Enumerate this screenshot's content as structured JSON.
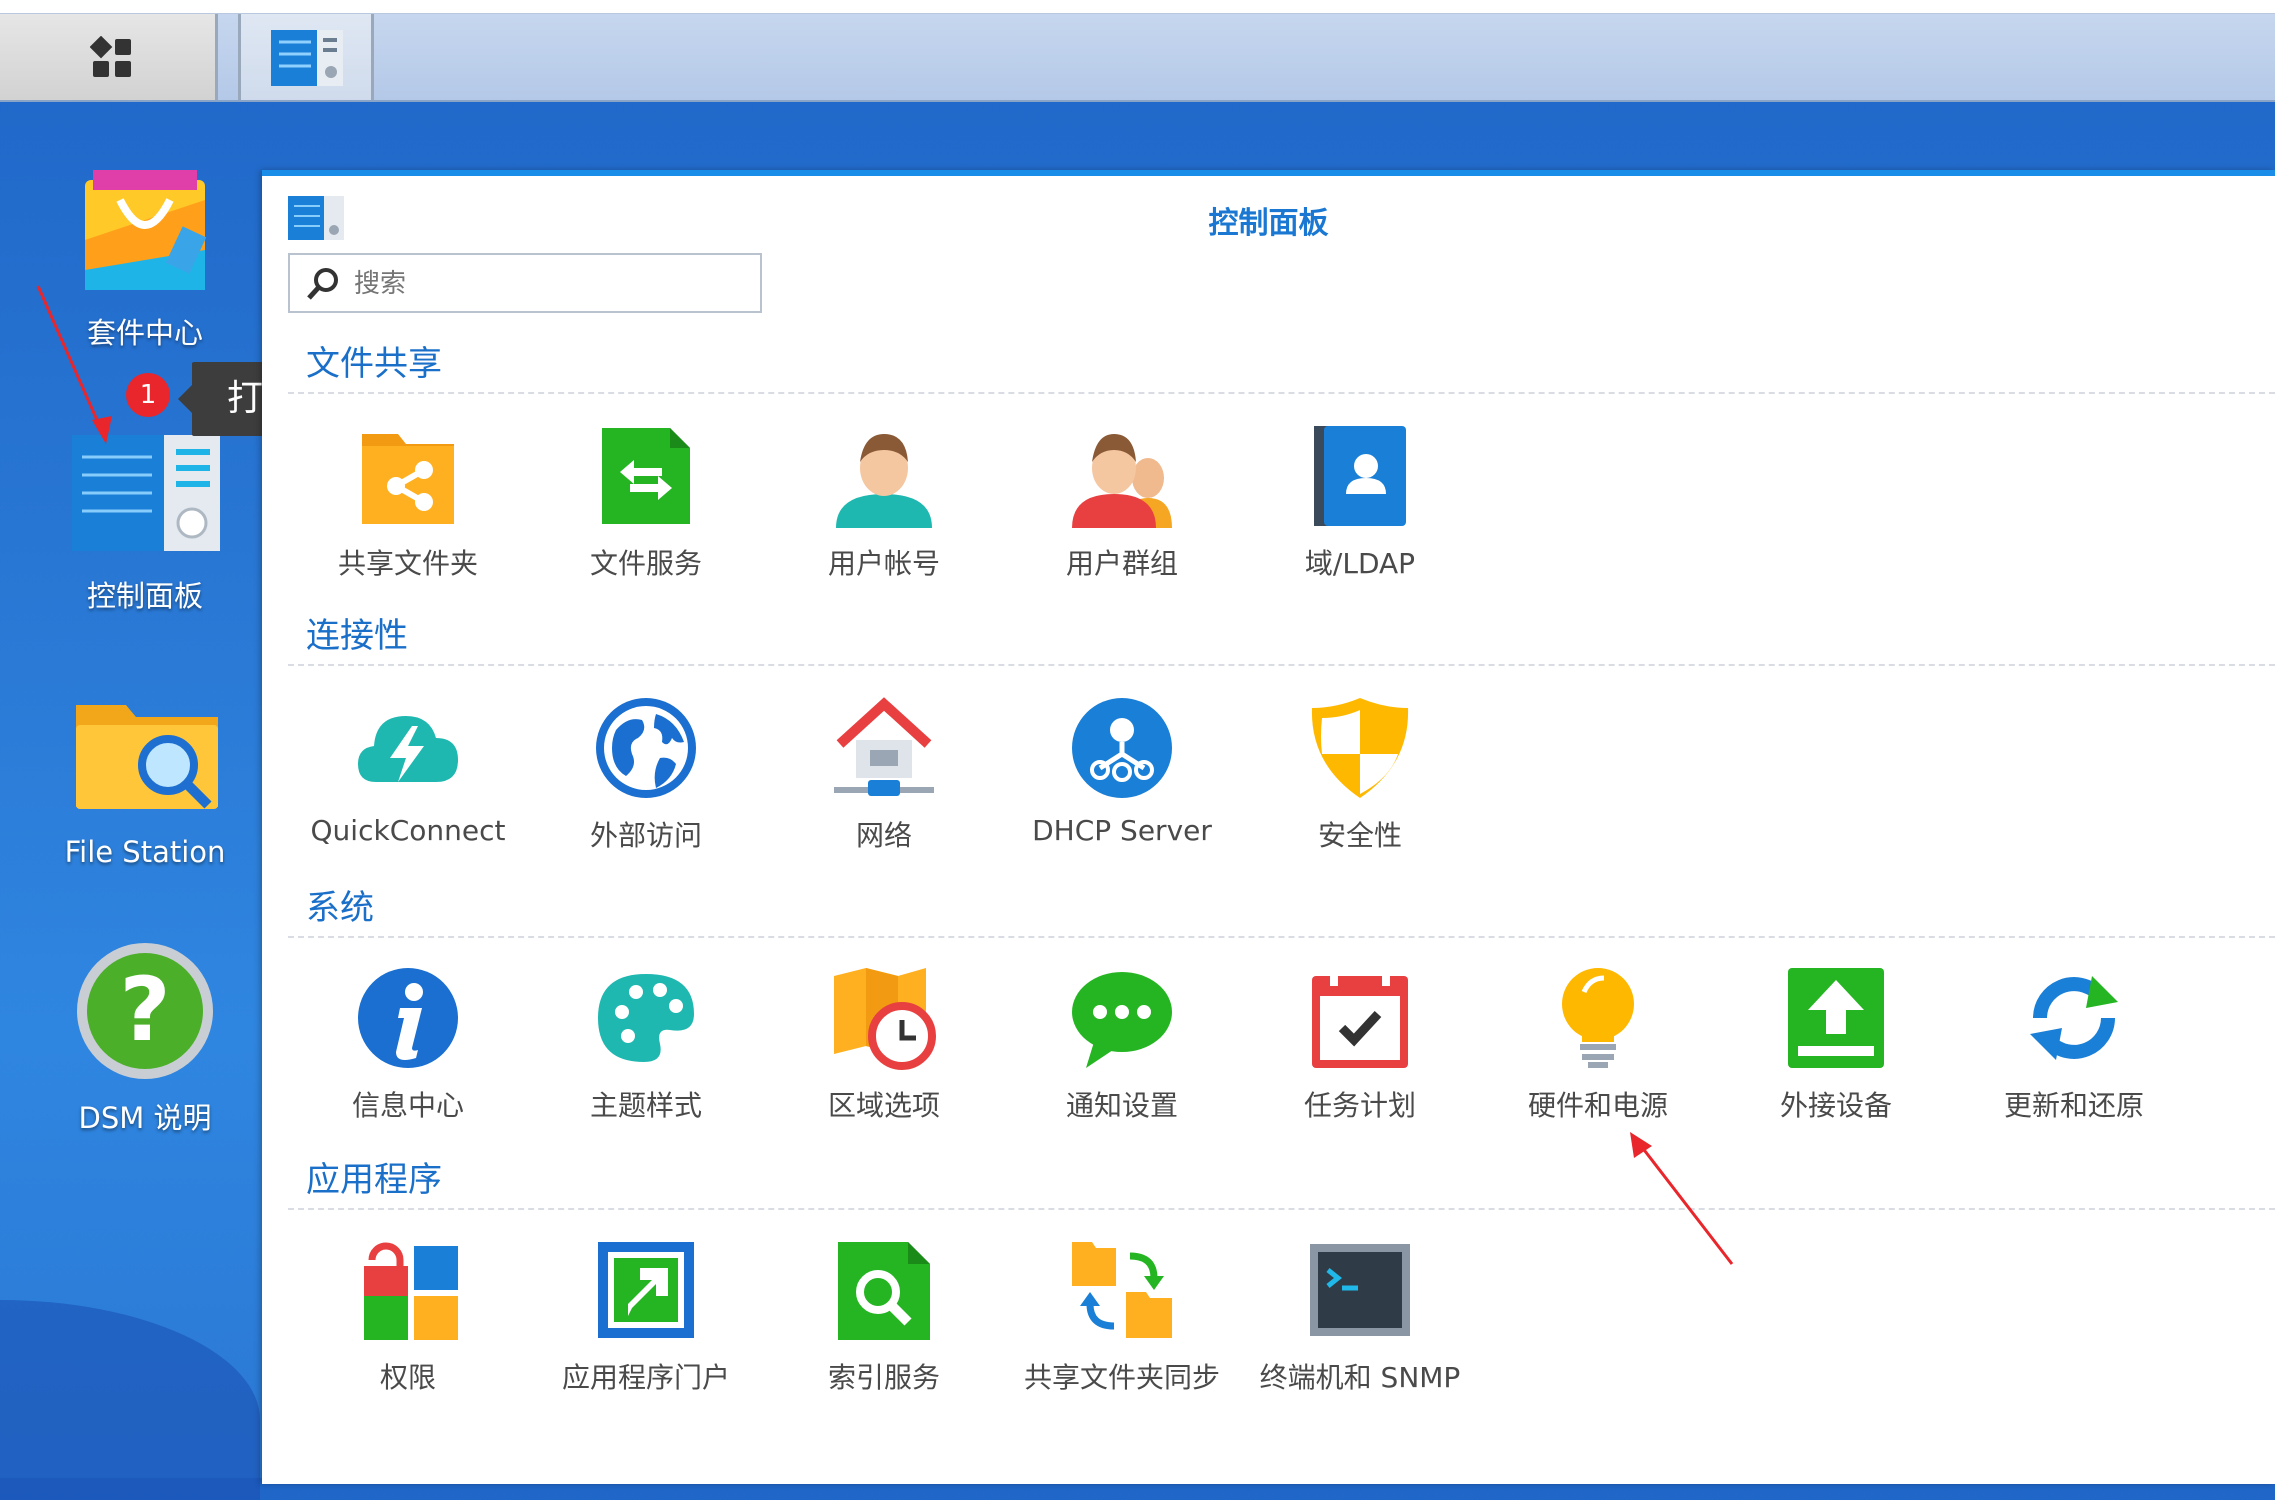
{
  "desktop": {
    "icons": [
      {
        "label": "套件中心",
        "icon": "package-center-icon"
      },
      {
        "label": "控制面板",
        "icon": "control-panel-icon"
      },
      {
        "label": "File Station",
        "icon": "file-station-icon"
      },
      {
        "label": "DSM 说明",
        "icon": "help-icon"
      }
    ],
    "tooltip": {
      "badge": "1",
      "text": "打开"
    }
  },
  "taskbar": {
    "main_menu_icon": "main-menu-icon",
    "open_app_icon": "control-panel-icon"
  },
  "window": {
    "title": "控制面板",
    "search": {
      "placeholder": "搜索"
    },
    "sections": [
      {
        "title": "文件共享",
        "items": [
          {
            "label": "共享文件夹",
            "icon": "shared-folder-icon"
          },
          {
            "label": "文件服务",
            "icon": "file-services-icon"
          },
          {
            "label": "用户帐号",
            "icon": "user-icon"
          },
          {
            "label": "用户群组",
            "icon": "group-icon"
          },
          {
            "label": "域/LDAP",
            "icon": "ldap-icon"
          }
        ]
      },
      {
        "title": "连接性",
        "items": [
          {
            "label": "QuickConnect",
            "icon": "quickconnect-icon"
          },
          {
            "label": "外部访问",
            "icon": "globe-icon"
          },
          {
            "label": "网络",
            "icon": "network-house-icon"
          },
          {
            "label": "DHCP Server",
            "icon": "dhcp-icon"
          },
          {
            "label": "安全性",
            "icon": "shield-icon"
          }
        ]
      },
      {
        "title": "系统",
        "items": [
          {
            "label": "信息中心",
            "icon": "info-icon"
          },
          {
            "label": "主题样式",
            "icon": "palette-icon"
          },
          {
            "label": "区域选项",
            "icon": "regional-map-clock-icon"
          },
          {
            "label": "通知设置",
            "icon": "chat-bubble-icon"
          },
          {
            "label": "任务计划",
            "icon": "calendar-check-icon"
          },
          {
            "label": "硬件和电源",
            "icon": "lightbulb-icon"
          },
          {
            "label": "外接设备",
            "icon": "external-device-icon"
          },
          {
            "label": "更新和还原",
            "icon": "update-restore-icon"
          }
        ]
      },
      {
        "title": "应用程序",
        "items": [
          {
            "label": "权限",
            "icon": "privileges-icon"
          },
          {
            "label": "应用程序门户",
            "icon": "application-portal-icon"
          },
          {
            "label": "索引服务",
            "icon": "indexing-service-icon"
          },
          {
            "label": "共享文件夹同步",
            "icon": "folder-sync-icon"
          },
          {
            "label": "终端机和 SNMP",
            "icon": "terminal-icon"
          }
        ]
      }
    ]
  },
  "annotations": {
    "arrow_color": "#e8262b"
  }
}
